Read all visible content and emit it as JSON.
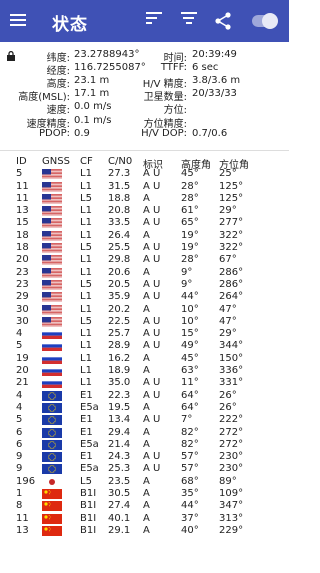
{
  "appbar": {
    "title": "状态"
  },
  "fix": {
    "rows_left": [
      {
        "label": "纬度:",
        "value": "23.2788943°"
      },
      {
        "label": "经度:",
        "value": "116.7255087°"
      },
      {
        "label": "高度:",
        "value": "23.1 m"
      },
      {
        "label": "高度(MSL):",
        "value": "17.1 m"
      },
      {
        "label": "速度:",
        "value": "0.0 m/s"
      },
      {
        "label": "速度精度:",
        "value": "0.1 m/s"
      },
      {
        "label": "PDOP:",
        "value": "0.9"
      }
    ],
    "rows_right": [
      {
        "label": "时间:",
        "value": "20:39:49"
      },
      {
        "label": "TTFF:",
        "value": "6 sec"
      },
      {
        "label": "H/V 精度:",
        "value": "3.8/3.6 m"
      },
      {
        "label": "卫星数量:",
        "value": "20/33/33"
      },
      {
        "label": "方位:",
        "value": ""
      },
      {
        "label": "方位精度:",
        "value": ""
      },
      {
        "label": "H/V DOP:",
        "value": "0.7/0.6"
      }
    ]
  },
  "table": {
    "headers": {
      "id": "ID",
      "gnss": "GNSS",
      "cf": "CF",
      "cn0": "C/N0",
      "mark": "标识",
      "el": "高度角",
      "az": "方位角"
    },
    "rows": [
      {
        "id": "5",
        "gnss": "US",
        "cf": "L1",
        "cn0": "27.3",
        "mark": "A U",
        "el": "45°",
        "az": "25°"
      },
      {
        "id": "11",
        "gnss": "US",
        "cf": "L1",
        "cn0": "31.5",
        "mark": "A U",
        "el": "28°",
        "az": "125°"
      },
      {
        "id": "11",
        "gnss": "US",
        "cf": "L5",
        "cn0": "18.8",
        "mark": "A",
        "el": "28°",
        "az": "125°"
      },
      {
        "id": "13",
        "gnss": "US",
        "cf": "L1",
        "cn0": "20.8",
        "mark": "A U",
        "el": "61°",
        "az": "29°"
      },
      {
        "id": "15",
        "gnss": "US",
        "cf": "L1",
        "cn0": "33.5",
        "mark": "A U",
        "el": "65°",
        "az": "277°"
      },
      {
        "id": "18",
        "gnss": "US",
        "cf": "L1",
        "cn0": "26.4",
        "mark": "A",
        "el": "19°",
        "az": "322°"
      },
      {
        "id": "18",
        "gnss": "US",
        "cf": "L5",
        "cn0": "25.5",
        "mark": "A U",
        "el": "19°",
        "az": "322°"
      },
      {
        "id": "20",
        "gnss": "US",
        "cf": "L1",
        "cn0": "29.8",
        "mark": "A U",
        "el": "28°",
        "az": "67°"
      },
      {
        "id": "23",
        "gnss": "US",
        "cf": "L1",
        "cn0": "20.6",
        "mark": "A",
        "el": "9°",
        "az": "286°"
      },
      {
        "id": "23",
        "gnss": "US",
        "cf": "L5",
        "cn0": "20.5",
        "mark": "A U",
        "el": "9°",
        "az": "286°"
      },
      {
        "id": "29",
        "gnss": "US",
        "cf": "L1",
        "cn0": "35.9",
        "mark": "A U",
        "el": "44°",
        "az": "264°"
      },
      {
        "id": "30",
        "gnss": "US",
        "cf": "L1",
        "cn0": "20.2",
        "mark": "A",
        "el": "10°",
        "az": "47°"
      },
      {
        "id": "30",
        "gnss": "US",
        "cf": "L5",
        "cn0": "22.5",
        "mark": "A U",
        "el": "10°",
        "az": "47°"
      },
      {
        "id": "4",
        "gnss": "RU",
        "cf": "L1",
        "cn0": "25.7",
        "mark": "A U",
        "el": "15°",
        "az": "29°"
      },
      {
        "id": "5",
        "gnss": "RU",
        "cf": "L1",
        "cn0": "28.9",
        "mark": "A U",
        "el": "49°",
        "az": "344°"
      },
      {
        "id": "19",
        "gnss": "RU",
        "cf": "L1",
        "cn0": "16.2",
        "mark": "A",
        "el": "45°",
        "az": "150°"
      },
      {
        "id": "20",
        "gnss": "RU",
        "cf": "L1",
        "cn0": "18.9",
        "mark": "A",
        "el": "63°",
        "az": "336°"
      },
      {
        "id": "21",
        "gnss": "RU",
        "cf": "L1",
        "cn0": "35.0",
        "mark": "A U",
        "el": "11°",
        "az": "331°"
      },
      {
        "id": "4",
        "gnss": "EU",
        "cf": "E1",
        "cn0": "22.3",
        "mark": "A U",
        "el": "64°",
        "az": "26°"
      },
      {
        "id": "4",
        "gnss": "EU",
        "cf": "E5a",
        "cn0": "19.5",
        "mark": "A",
        "el": "64°",
        "az": "26°"
      },
      {
        "id": "5",
        "gnss": "EU",
        "cf": "E1",
        "cn0": "13.4",
        "mark": "A U",
        "el": "7°",
        "az": "222°"
      },
      {
        "id": "6",
        "gnss": "EU",
        "cf": "E1",
        "cn0": "29.4",
        "mark": "A",
        "el": "82°",
        "az": "272°"
      },
      {
        "id": "6",
        "gnss": "EU",
        "cf": "E5a",
        "cn0": "21.4",
        "mark": "A",
        "el": "82°",
        "az": "272°"
      },
      {
        "id": "9",
        "gnss": "EU",
        "cf": "E1",
        "cn0": "24.3",
        "mark": "A U",
        "el": "57°",
        "az": "230°"
      },
      {
        "id": "9",
        "gnss": "EU",
        "cf": "E5a",
        "cn0": "25.3",
        "mark": "A U",
        "el": "57°",
        "az": "230°"
      },
      {
        "id": "196",
        "gnss": "JP",
        "cf": "L5",
        "cn0": "23.5",
        "mark": "A",
        "el": "68°",
        "az": "89°"
      },
      {
        "id": "1",
        "gnss": "CN",
        "cf": "B1I",
        "cn0": "30.5",
        "mark": "A",
        "el": "35°",
        "az": "109°"
      },
      {
        "id": "8",
        "gnss": "CN",
        "cf": "B1I",
        "cn0": "27.4",
        "mark": "A",
        "el": "44°",
        "az": "347°"
      },
      {
        "id": "11",
        "gnss": "CN",
        "cf": "B1I",
        "cn0": "40.1",
        "mark": "A",
        "el": "37°",
        "az": "313°"
      },
      {
        "id": "13",
        "gnss": "CN",
        "cf": "B1I",
        "cn0": "29.1",
        "mark": "A",
        "el": "40°",
        "az": "229°"
      }
    ]
  },
  "colors": {
    "appbar": "#3f51b5",
    "toggle_track": "#9fa8da"
  }
}
